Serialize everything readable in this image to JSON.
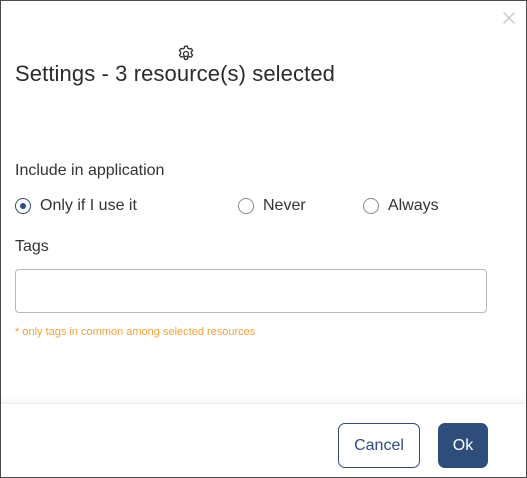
{
  "dialog": {
    "title": "Settings - 3 resource(s) selected",
    "close_icon": "close-icon",
    "header_icon": "gear-icon"
  },
  "include": {
    "label": "Include in application",
    "options": [
      {
        "label": "Only if I use it",
        "selected": true
      },
      {
        "label": "Never",
        "selected": false
      },
      {
        "label": "Always",
        "selected": false
      }
    ]
  },
  "tags": {
    "label": "Tags",
    "value": "",
    "placeholder": "",
    "hint": "* only tags in common among selected resources"
  },
  "footer": {
    "cancel_label": "Cancel",
    "ok_label": "Ok"
  },
  "colors": {
    "primary": "#2e4d7b",
    "hint": "#f2a23c",
    "border": "#b8b8b8"
  }
}
